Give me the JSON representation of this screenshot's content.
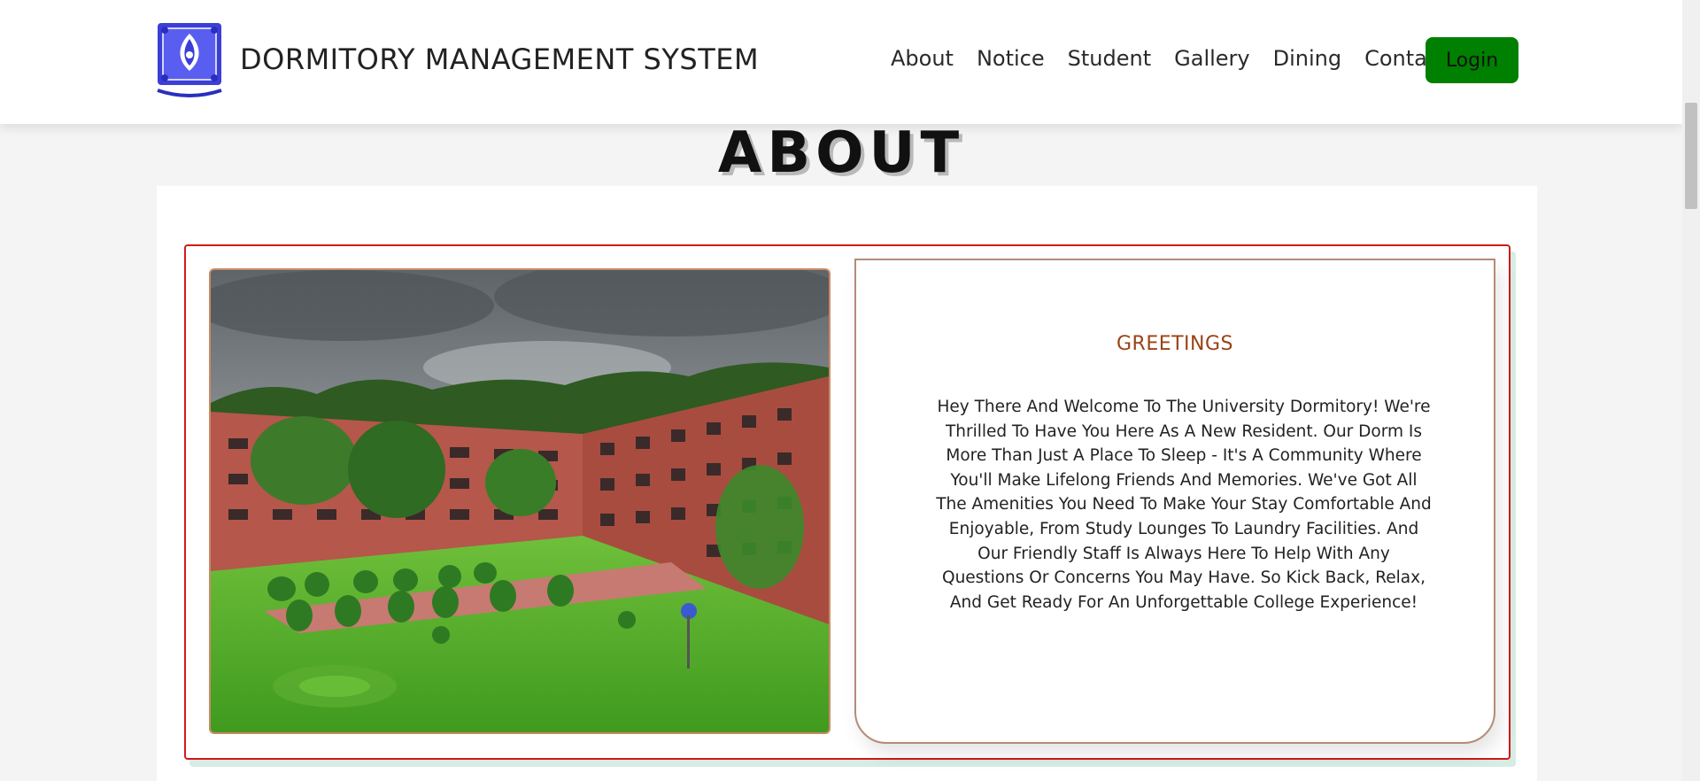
{
  "header": {
    "title": "DORMITORY MANAGEMENT SYSTEM",
    "logo_icon": "university-seal-icon",
    "nav": [
      "About",
      "Notice",
      "Student",
      "Gallery",
      "Dining",
      "Contact"
    ],
    "login_label": "Login"
  },
  "about": {
    "heading": "ABOUT",
    "image_icon": "dormitory-courtyard-photo",
    "greeting_title": "GREETINGS",
    "greeting_text": "Hey There And Welcome To The University Dormitory! We're Thrilled To Have You Here As A New Resident. Our Dorm Is More Than Just A Place To Sleep - It's A Community Where You'll Make Lifelong Friends And Memories. We've Got All The Amenities You Need To Make Your Stay Comfortable And Enjoyable, From Study Lounges To Laundry Facilities. And Our Friendly Staff Is Always Here To Help With Any Questions Or Concerns You May Have. So Kick Back, Relax, And Get Ready For An Unforgettable College Experience!"
  },
  "colors": {
    "login_bg": "#008000",
    "greeting_title": "#9a4316",
    "frame_border": "#d11919"
  }
}
